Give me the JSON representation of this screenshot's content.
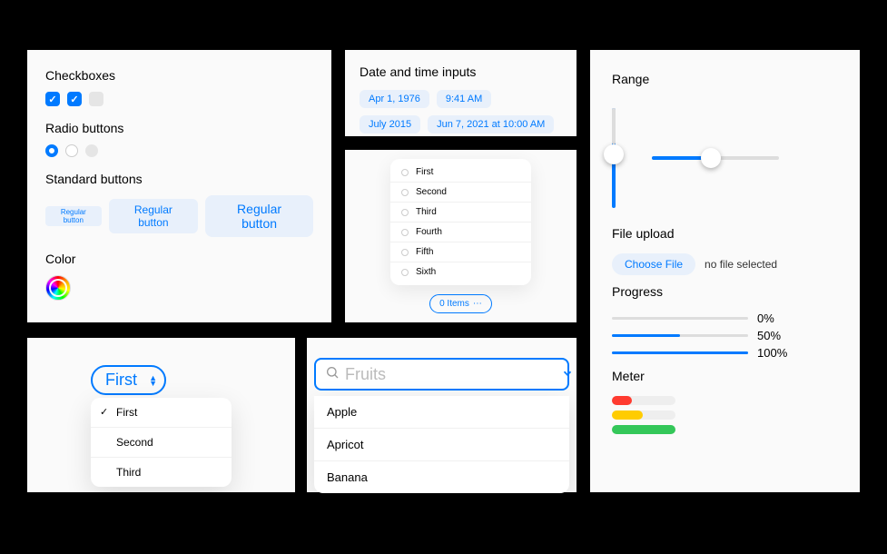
{
  "panel1": {
    "checkboxes_label": "Checkboxes",
    "radio_label": "Radio buttons",
    "buttons_label": "Standard buttons",
    "btn_text": "Regular button",
    "color_label": "Color"
  },
  "panel2": {
    "title": "Date and time inputs",
    "pills": [
      "Apr 1, 1976",
      "9:41 AM",
      "July 2015",
      "Jun 7, 2021 at 10:00 AM"
    ]
  },
  "panel3": {
    "items": [
      "First",
      "Second",
      "Third",
      "Fourth",
      "Fifth",
      "Sixth"
    ],
    "summary": "0 Items"
  },
  "panel4": {
    "selected": "First",
    "options": [
      "First",
      "Second",
      "Third"
    ]
  },
  "panel5": {
    "placeholder": "Fruits",
    "suggestions": [
      "Apple",
      "Apricot",
      "Banana"
    ]
  },
  "panel6": {
    "range_label": "Range",
    "file_label": "File upload",
    "file_btn": "Choose File",
    "file_status": "no file selected",
    "progress_label": "Progress",
    "progress": [
      {
        "value": 0,
        "label": "0%"
      },
      {
        "value": 50,
        "label": "50%"
      },
      {
        "value": 100,
        "label": "100%"
      }
    ],
    "meter_label": "Meter"
  }
}
